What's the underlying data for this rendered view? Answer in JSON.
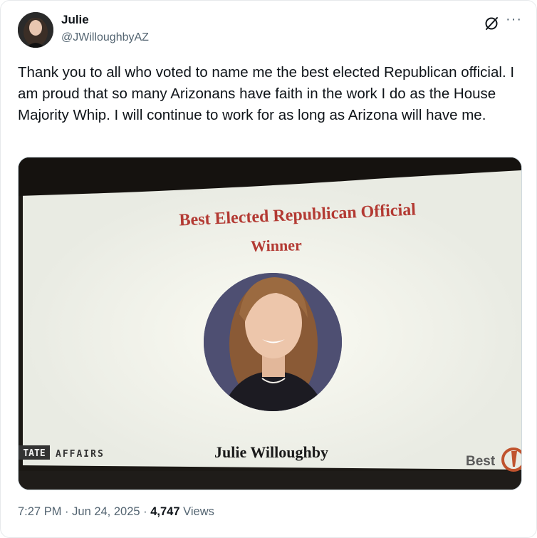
{
  "author": {
    "name": "Julie",
    "handle": "@JWilloughbyAZ"
  },
  "header_icons": [
    "grok-icon",
    "more-options-icon"
  ],
  "more_label": "···",
  "tweet": {
    "text": "Thank you to all who voted to name me the best elected Republican official. I am proud that so many Arizonans have faith in the work I do as the House Majority Whip. I will continue to work for as long as Arizona will have me."
  },
  "media": {
    "slide_title": "Best Elected Republican Official",
    "slide_subtitle": "Winner",
    "winner_name": "Julie Willoughby",
    "left_logo": "TATE",
    "left_logo_suffix": "AFFAIRS",
    "right_logo": "Best",
    "title_color": "#b33a33"
  },
  "meta": {
    "time": "7:27 PM",
    "sep1": "·",
    "date": "Jun 24, 2025",
    "sep2": "·",
    "views_count": "4,747",
    "views_label": "Views"
  }
}
